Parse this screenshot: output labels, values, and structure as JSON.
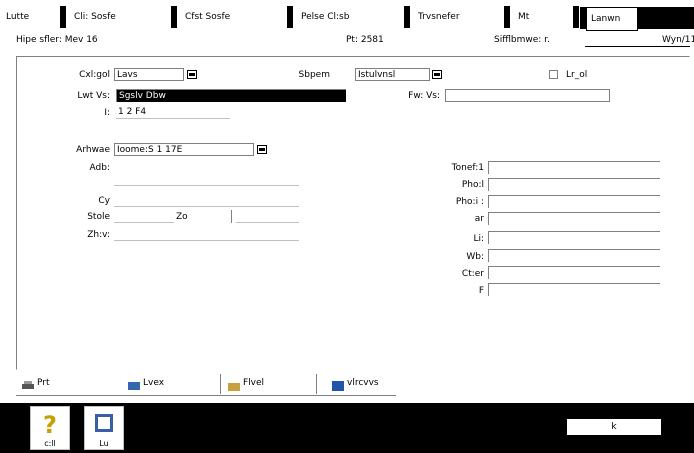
{
  "tabs": [
    {
      "label": "Lutte"
    },
    {
      "label": "Cli: Sosfe"
    },
    {
      "label": "Cfst Sosfe"
    },
    {
      "label": "Pelse Cl:sb"
    },
    {
      "label": "Trvsnefer"
    },
    {
      "label": "Mt"
    },
    {
      "label": "Lanwn"
    }
  ],
  "header": {
    "left": "Hipe sfler: Mev 16",
    "center": "Pt: 2581",
    "right_label": "Sifflbmwe: r.",
    "right_value": "Wyn/11"
  },
  "form": {
    "category_label": "Cxl:gol",
    "category_value": "Lavs",
    "status_label": "Sbpem",
    "status_value": "Istulvnsl",
    "check_label": "Lr_ol",
    "name1_label": "Lwt Vs:",
    "name1_value": "Sgslv  Dbw",
    "name2_label": "Fw: Vs:",
    "name2_value": "",
    "id_label": "I:",
    "id_value": "1 2 F4",
    "address_type_label": "Arhwae",
    "address_type_value": "Ioome:S  1 17E",
    "address_label": "Adb:",
    "city_label": "Cy",
    "state_label": "Stole",
    "zip_label": "Zo",
    "country_label": "Zh:v:",
    "phone1_label": "Tonef:1",
    "phone2_label": "Pho:l",
    "phone3_label": "Pho:i :",
    "fax_label": "ar",
    "email_label": "Li:",
    "web_label": "Wb:",
    "other_label": "Ct:er",
    "note_label": "F"
  },
  "bottom_tabs": [
    {
      "label": "Prt",
      "icon": "printer-icon"
    },
    {
      "label": "Lvex",
      "icon": "list-icon"
    },
    {
      "label": "Flvel",
      "icon": "folder-icon"
    },
    {
      "label": "vlrcvvs",
      "icon": "globe-icon"
    }
  ],
  "toolbar": {
    "help_label": "c:ll",
    "tools_label": "Lu",
    "ok_label": "k"
  }
}
